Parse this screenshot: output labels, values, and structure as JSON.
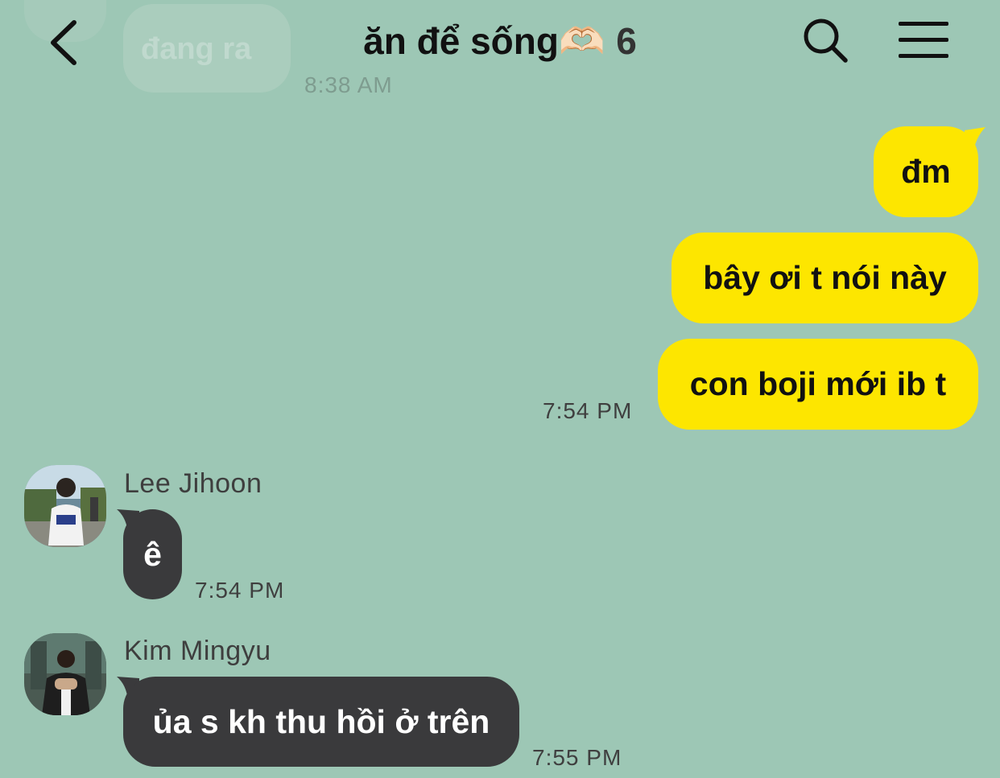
{
  "header": {
    "title": "ăn để sống🫶🏻",
    "member_count": "6",
    "back_icon": "chevron-left-icon",
    "search_icon": "search-icon",
    "menu_icon": "hamburger-menu-icon"
  },
  "faded_message": {
    "text": "đang ra",
    "time": "8:38 AM"
  },
  "outgoing": {
    "messages": [
      "đm",
      "bây ơi t nói này",
      "con boji mới ib t"
    ],
    "time": "7:54 PM",
    "bubble_color": "#fde600"
  },
  "incoming": [
    {
      "sender": "Lee Jihoon",
      "text": "ê",
      "time": "7:54 PM"
    },
    {
      "sender": "Kim Mingyu",
      "text": "ủa s kh thu hồi ở trên",
      "time": "7:55 PM"
    }
  ],
  "colors": {
    "background": "#9dc7b5",
    "incoming_bubble": "#3a3a3c",
    "outgoing_bubble": "#fde600"
  }
}
